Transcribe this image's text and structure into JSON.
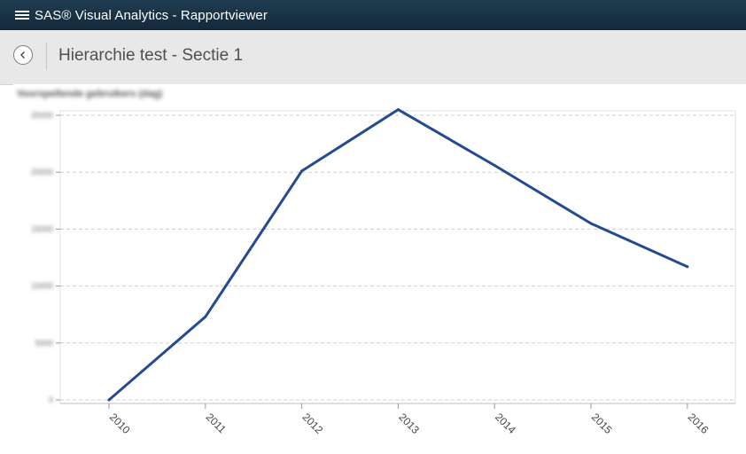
{
  "app": {
    "title": "SAS® Visual Analytics - Rapportviewer"
  },
  "header": {
    "page_title": "Hierarchie test - Sectie 1"
  },
  "colors": {
    "titlebar": "#1a3347",
    "line": "#244a91",
    "gridline": "#cfcfcf"
  },
  "icons": {
    "menu": "menu-icon",
    "back": "back-arrow-icon"
  },
  "chart_data": {
    "type": "line",
    "title": "Voorspellende gebruikers (dag)",
    "xlabel": "",
    "ylabel": "",
    "x": [
      "2010",
      "2011",
      "2012",
      "2013",
      "2014",
      "2015",
      "2016"
    ],
    "series": [
      {
        "values": [
          0,
          7300,
          20100,
          25500,
          20600,
          15500,
          11700
        ]
      }
    ],
    "ylim": [
      0,
      25000
    ],
    "yticks": [
      "0",
      "5000",
      "10000",
      "15000",
      "20000",
      "25000"
    ],
    "grid": true,
    "legend": "none"
  }
}
